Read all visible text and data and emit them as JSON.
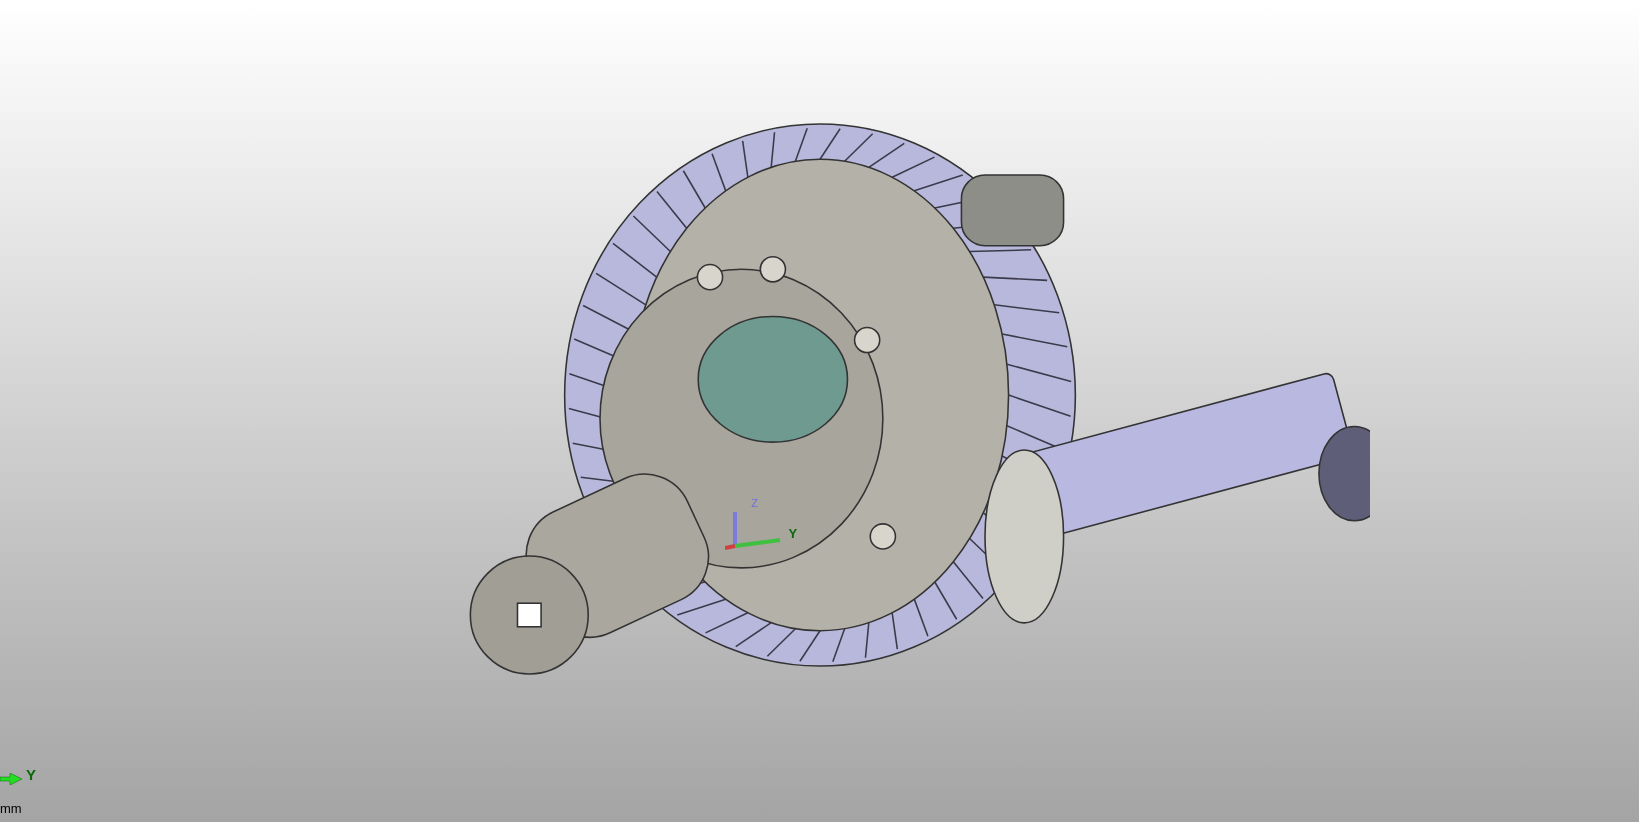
{
  "viewport": {
    "origin_triad": {
      "z_label": "Z",
      "y_label": "Y"
    },
    "corner_triad": {
      "y_label": "Y"
    },
    "units": "mm"
  }
}
